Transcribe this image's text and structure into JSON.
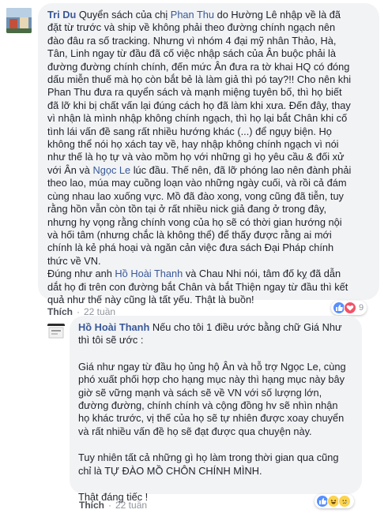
{
  "colors": {
    "link": "#385898",
    "bubble": "#f2f3f5",
    "meta": "#90949c"
  },
  "comment1": {
    "author": "Tri Du",
    "lines": [
      [
        {
          "t": "Tri Du",
          "k": "author"
        },
        {
          "t": " Quyển sách của chị "
        },
        {
          "t": "Phan Thu",
          "k": "mention"
        },
        {
          "t": " do Hường Lê nhập về là đã"
        }
      ],
      [
        {
          "t": "đặt từ trước và ship về không phải theo đường chính ngạch nên"
        }
      ],
      [
        {
          "t": "đào đâu ra số tracking. Nhưng vì nhóm 4 đại mỹ nhân Thảo, Hà,"
        }
      ],
      [
        {
          "t": "Tân, Linh ngay từ đầu đã cố việc nhập sách của Ân buộc phải là"
        }
      ],
      [
        {
          "t": "đường đường chính chính, đến mức Ân đưa ra tờ khai HQ có đóng"
        }
      ],
      [
        {
          "t": "dấu miễn thuế mà họ còn bắt bẻ là làm giả thì pó tay?!! Cho nên khi"
        }
      ],
      [
        {
          "t": "Phan Thu đưa ra quyển sách và mạnh miệng tuyên bố, thì họ biết"
        }
      ],
      [
        {
          "t": "đã lỡ khi bị chất vấn lại đúng cách họ đã làm khi xưa. Đến đây, thay"
        }
      ],
      [
        {
          "t": "vì nhận là mình nhập không chính ngạch, thì họ lại bắt Chân khi cố"
        }
      ],
      [
        {
          "t": "tình lái vấn đề sang rất nhiều hướng khác (...) để ngụy biện. Họ"
        }
      ],
      [
        {
          "t": "không thể nói họ xách tay về, hay nhập không chính ngạch vì nói"
        }
      ],
      [
        {
          "t": "như thế là họ tự và vào mồm họ với những gì họ yêu cầu & đối xử"
        }
      ],
      [
        {
          "t": "với Ân và "
        },
        {
          "t": "Ngọc Le",
          "k": "mention"
        },
        {
          "t": " lúc đầu. Thế nên, đã lỡ phóng lao nên đành phải"
        }
      ],
      [
        {
          "t": "theo lao, múa may cuồng loạn vào những ngày cuối, và rồi cả đám"
        }
      ],
      [
        {
          "t": "cùng nhau lao xuống vực. Mồ đã đào xong, vong cũng đã tiễn, tuy"
        }
      ],
      [
        {
          "t": "rằng hồn vẫn còn tồn tại ở rất nhiều nick giả đang ở trong đây,"
        }
      ],
      [
        {
          "t": "nhưng hy vọng rằng chính vong của họ sẽ có thời gian hướng nội"
        }
      ],
      [
        {
          "t": "và hối tâm (nhưng chắc là không thể) để thấy được rằng ai mới"
        }
      ],
      [
        {
          "t": "chính là kẻ phá hoại và ngăn cản việc đưa sách Đại Pháp chính"
        }
      ],
      [
        {
          "t": "thức về VN."
        }
      ],
      [
        {
          "t": "Đúng như anh "
        },
        {
          "t": "Hồ Hoài Thanh",
          "k": "mention"
        },
        {
          "t": " và Chau Nhi nói, tâm đố kỵ đã dẫn"
        }
      ],
      [
        {
          "t": "dắt họ đi trên con đường bắt Chân và bắt Thiện ngay từ đầu thì kết"
        }
      ],
      [
        {
          "t": "quả như thế này cũng là tất yếu. Thật là buồn!"
        }
      ]
    ],
    "action_like": "Thích",
    "time": "22 tuần",
    "reaction_count": "9"
  },
  "comment2": {
    "author": "Hồ Hoài Thanh",
    "header_lines": [
      [
        {
          "t": "Hồ Hoài Thanh",
          "k": "author"
        },
        {
          "t": " Nếu cho tôi 1 điều ước bằng chữ Giá Như"
        }
      ],
      [
        {
          "t": "thì tôi sẽ ước :"
        }
      ]
    ],
    "para1": [
      [
        {
          "t": "Giá như ngay từ đầu họ ủng hộ Ân và hỗ trợ Ngọc Le, cùng"
        }
      ],
      [
        {
          "t": "phó xuất phối hợp cho hạng mục này thì hạng mục này bây"
        }
      ],
      [
        {
          "t": "giờ sẽ vững mạnh và sách sẽ về VN với số lượng lớn,"
        }
      ],
      [
        {
          "t": "đường đường, chính chính và cộng đồng hv sẽ nhìn nhận"
        }
      ],
      [
        {
          "t": "họ khác trước, vị thế của họ sẽ tự nhiên được xoay chuyển"
        }
      ],
      [
        {
          "t": "và rất nhiều vấn đề họ sẽ đạt được qua chuyện này."
        }
      ]
    ],
    "para2": [
      [
        {
          "t": "Tuy nhiên tất cả những gì họ làm trong thời gian qua cũng"
        }
      ],
      [
        {
          "t": "chỉ là TỰ ĐÀO MỒ CHÔN CHÍNH MÌNH."
        }
      ]
    ],
    "para3": [
      [
        {
          "t": "Thật đáng tiếc !"
        }
      ]
    ],
    "action_like": "Thích",
    "time": "22 tuần"
  }
}
